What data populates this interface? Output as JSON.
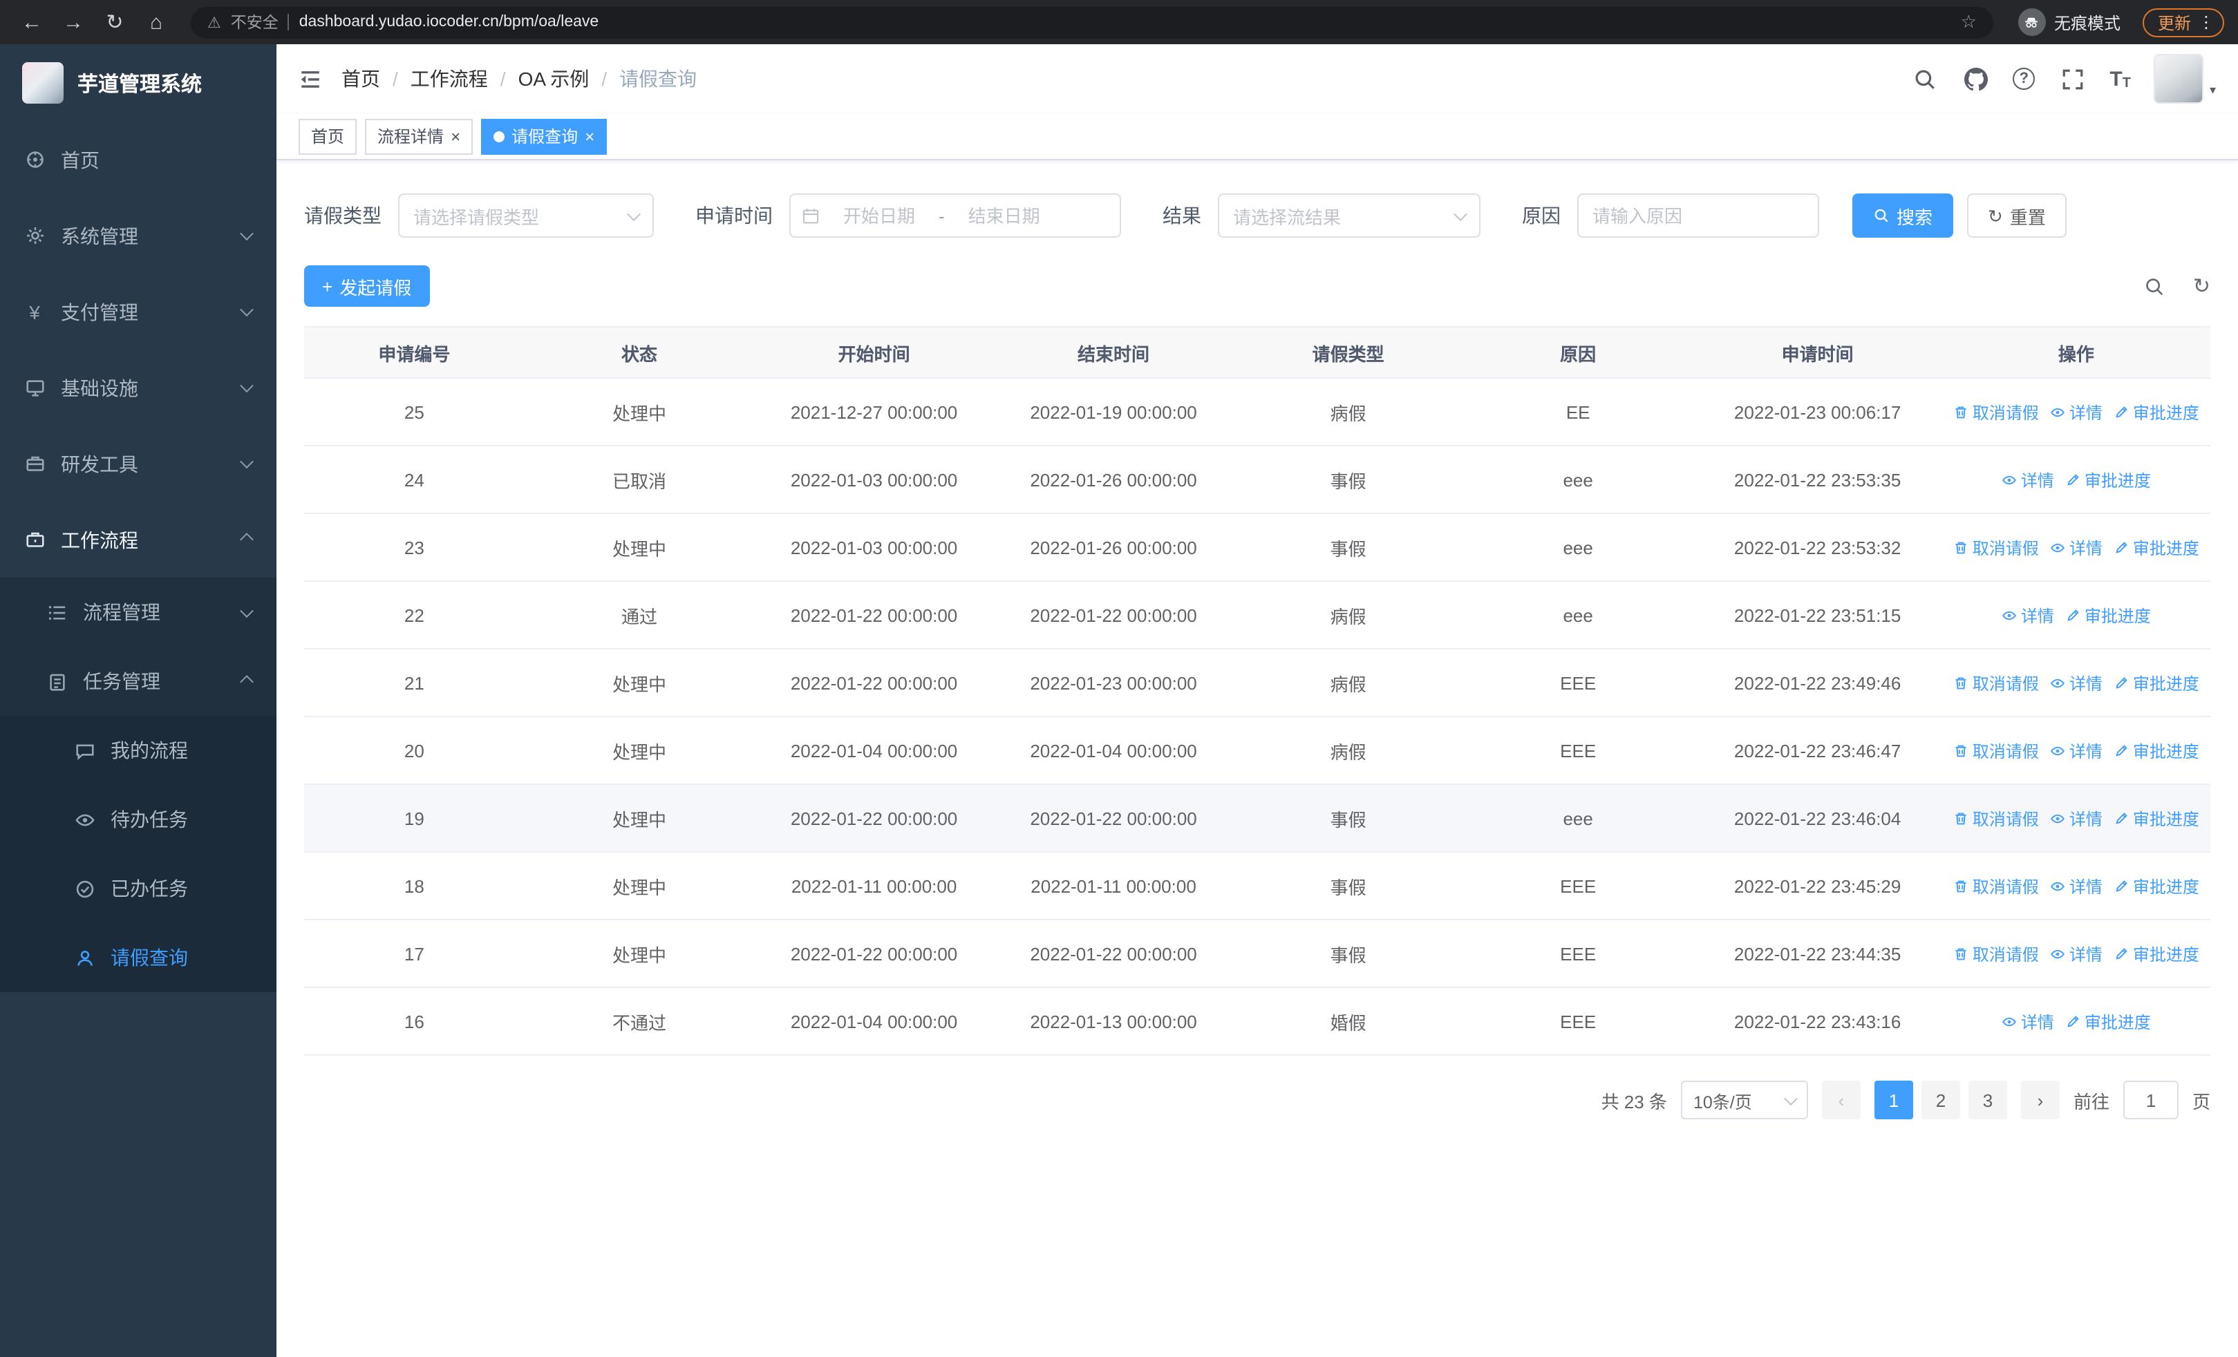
{
  "browser": {
    "security_label": "不安全",
    "url": "dashboard.yudao.iocoder.cn/bpm/oa/leave",
    "incognito_label": "无痕模式",
    "update_label": "更新"
  },
  "icons": {
    "back": "←",
    "forward": "→",
    "reload": "↻",
    "home": "⌂",
    "warning": "⚠",
    "star": "☆",
    "menu_dots": "⋮",
    "caret_down": "▾",
    "refresh": "↻",
    "plus": "+",
    "font_size_large": "T",
    "font_size_small": "T",
    "question_mark": "?",
    "prev": "‹",
    "next": "›"
  },
  "sidebar": {
    "app_title": "芋道管理系统",
    "items": [
      {
        "label": "首页",
        "icon": "home",
        "level": 1,
        "chevron": null,
        "active": false,
        "open": false
      },
      {
        "label": "系统管理",
        "icon": "gear",
        "level": 1,
        "chevron": "down",
        "active": false,
        "open": false
      },
      {
        "label": "支付管理",
        "icon": "yen",
        "level": 1,
        "chevron": "down",
        "active": false,
        "open": false
      },
      {
        "label": "基础设施",
        "icon": "infra",
        "level": 1,
        "chevron": "down",
        "active": false,
        "open": false
      },
      {
        "label": "研发工具",
        "icon": "tools",
        "level": 1,
        "chevron": "down",
        "active": false,
        "open": false
      },
      {
        "label": "工作流程",
        "icon": "workflow",
        "level": 1,
        "chevron": "up",
        "active": false,
        "open": true
      },
      {
        "label": "流程管理",
        "icon": "process",
        "level": 2,
        "chevron": "down",
        "active": false,
        "open": false
      },
      {
        "label": "任务管理",
        "icon": "task",
        "level": 2,
        "chevron": "up",
        "active": false,
        "open": false
      },
      {
        "label": "我的流程",
        "icon": "chat",
        "level": 3,
        "chevron": null,
        "active": false,
        "open": false
      },
      {
        "label": "待办任务",
        "icon": "eye",
        "level": 3,
        "chevron": null,
        "active": false,
        "open": false
      },
      {
        "label": "已办任务",
        "icon": "done",
        "level": 3,
        "chevron": null,
        "active": false,
        "open": false
      },
      {
        "label": "请假查询",
        "icon": "user",
        "level": 3,
        "chevron": null,
        "active": true,
        "open": false
      }
    ]
  },
  "navbar": {
    "breadcrumbs": [
      "首页",
      "工作流程",
      "OA 示例",
      "请假查询"
    ]
  },
  "tags": [
    {
      "label": "首页",
      "closable": false,
      "active": false
    },
    {
      "label": "流程详情",
      "closable": true,
      "active": false
    },
    {
      "label": "请假查询",
      "closable": true,
      "active": true
    }
  ],
  "filters": {
    "leave_type": {
      "label": "请假类型",
      "placeholder": "请选择请假类型"
    },
    "apply_time": {
      "label": "申请时间",
      "start_placeholder": "开始日期",
      "separator": "-",
      "end_placeholder": "结束日期"
    },
    "result": {
      "label": "结果",
      "placeholder": "请选择流结果"
    },
    "reason": {
      "label": "原因",
      "placeholder": "请输入原因"
    },
    "search_label": "搜索",
    "reset_label": "重置"
  },
  "toolbar": {
    "create_label": "发起请假"
  },
  "table": {
    "columns": [
      "申请编号",
      "状态",
      "开始时间",
      "结束时间",
      "请假类型",
      "原因",
      "申请时间",
      "操作"
    ],
    "action_labels": {
      "cancel": "取消请假",
      "detail": "详情",
      "progress": "审批进度"
    },
    "rows": [
      {
        "id": "25",
        "status": "处理中",
        "start_time": "2021-12-27 00:00:00",
        "end_time": "2022-01-19 00:00:00",
        "leave_type": "病假",
        "reason": "EE",
        "apply_time": "2022-01-23 00:06:17",
        "actions": [
          "cancel",
          "detail",
          "progress"
        ],
        "highlighted": false
      },
      {
        "id": "24",
        "status": "已取消",
        "start_time": "2022-01-03 00:00:00",
        "end_time": "2022-01-26 00:00:00",
        "leave_type": "事假",
        "reason": "eee",
        "apply_time": "2022-01-22 23:53:35",
        "actions": [
          "detail",
          "progress"
        ],
        "highlighted": false
      },
      {
        "id": "23",
        "status": "处理中",
        "start_time": "2022-01-03 00:00:00",
        "end_time": "2022-01-26 00:00:00",
        "leave_type": "事假",
        "reason": "eee",
        "apply_time": "2022-01-22 23:53:32",
        "actions": [
          "cancel",
          "detail",
          "progress"
        ],
        "highlighted": false
      },
      {
        "id": "22",
        "status": "通过",
        "start_time": "2022-01-22 00:00:00",
        "end_time": "2022-01-22 00:00:00",
        "leave_type": "病假",
        "reason": "eee",
        "apply_time": "2022-01-22 23:51:15",
        "actions": [
          "detail",
          "progress"
        ],
        "highlighted": false
      },
      {
        "id": "21",
        "status": "处理中",
        "start_time": "2022-01-22 00:00:00",
        "end_time": "2022-01-23 00:00:00",
        "leave_type": "病假",
        "reason": "EEE",
        "apply_time": "2022-01-22 23:49:46",
        "actions": [
          "cancel",
          "detail",
          "progress"
        ],
        "highlighted": false
      },
      {
        "id": "20",
        "status": "处理中",
        "start_time": "2022-01-04 00:00:00",
        "end_time": "2022-01-04 00:00:00",
        "leave_type": "病假",
        "reason": "EEE",
        "apply_time": "2022-01-22 23:46:47",
        "actions": [
          "cancel",
          "detail",
          "progress"
        ],
        "highlighted": false
      },
      {
        "id": "19",
        "status": "处理中",
        "start_time": "2022-01-22 00:00:00",
        "end_time": "2022-01-22 00:00:00",
        "leave_type": "事假",
        "reason": "eee",
        "apply_time": "2022-01-22 23:46:04",
        "actions": [
          "cancel",
          "detail",
          "progress"
        ],
        "highlighted": true
      },
      {
        "id": "18",
        "status": "处理中",
        "start_time": "2022-01-11 00:00:00",
        "end_time": "2022-01-11 00:00:00",
        "leave_type": "事假",
        "reason": "EEE",
        "apply_time": "2022-01-22 23:45:29",
        "actions": [
          "cancel",
          "detail",
          "progress"
        ],
        "highlighted": false
      },
      {
        "id": "17",
        "status": "处理中",
        "start_time": "2022-01-22 00:00:00",
        "end_time": "2022-01-22 00:00:00",
        "leave_type": "事假",
        "reason": "EEE",
        "apply_time": "2022-01-22 23:44:35",
        "actions": [
          "cancel",
          "detail",
          "progress"
        ],
        "highlighted": false
      },
      {
        "id": "16",
        "status": "不通过",
        "start_time": "2022-01-04 00:00:00",
        "end_time": "2022-01-13 00:00:00",
        "leave_type": "婚假",
        "reason": "EEE",
        "apply_time": "2022-01-22 23:43:16",
        "actions": [
          "detail",
          "progress"
        ],
        "highlighted": false
      }
    ]
  },
  "pagination": {
    "total_label": "共 23 条",
    "page_size_label": "10条/页",
    "pages": [
      "1",
      "2",
      "3"
    ],
    "active_page": "1",
    "goto_label": "前往",
    "goto_value": "1",
    "unit_label": "页"
  }
}
